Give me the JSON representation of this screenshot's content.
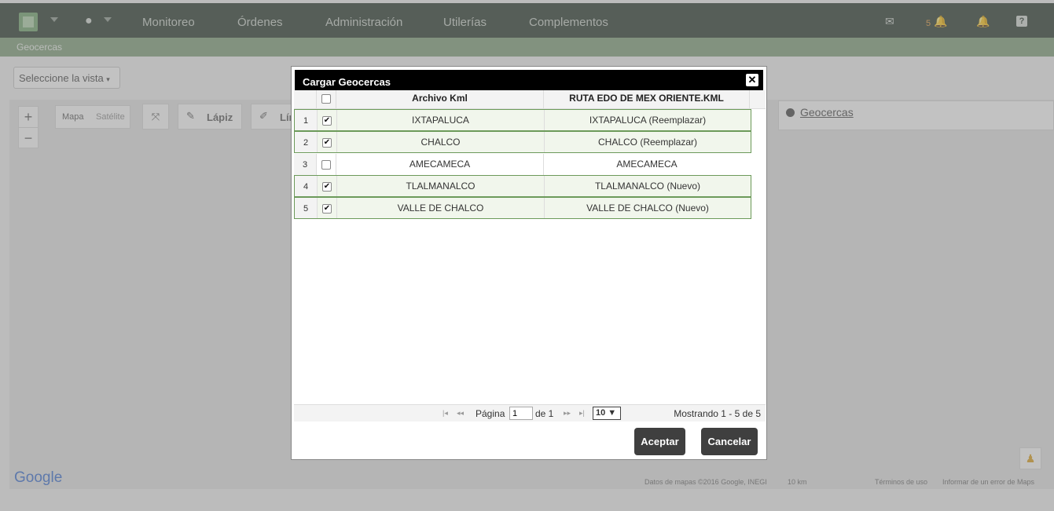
{
  "topbar": {
    "nav": [
      "Monitoreo",
      "Órdenes",
      "Administración",
      "Utilerías",
      "Complementos"
    ],
    "notifications_count": "5"
  },
  "subbar": {
    "title": "Geocercas"
  },
  "view_select": {
    "label": "Seleccione la vista"
  },
  "map": {
    "zoom_in": "+",
    "zoom_out": "−",
    "map_type": [
      "Mapa",
      "Satélite"
    ],
    "tool_pencil": "Lápiz",
    "tool_line": "Lín",
    "google": "Google",
    "footer": [
      "Datos de mapas ©2016 Google, INEGI",
      "10 km",
      "Términos de uso",
      "Informar de un error de Maps"
    ],
    "layers_link": "Geocercas"
  },
  "dialog": {
    "title": "Cargar Geocercas",
    "columns": [
      "Archivo Kml",
      "RUTA EDO DE MEX ORIENTE.KML"
    ],
    "rows": [
      {
        "num": "1",
        "checked": true,
        "archivo": "IXTAPALUCA",
        "ruta": "IXTAPALUCA (Reemplazar)"
      },
      {
        "num": "2",
        "checked": true,
        "archivo": "CHALCO",
        "ruta": "CHALCO (Reemplazar)"
      },
      {
        "num": "3",
        "checked": false,
        "archivo": "AMECAMECA",
        "ruta": "AMECAMECA"
      },
      {
        "num": "4",
        "checked": true,
        "archivo": "TLALMANALCO",
        "ruta": "TLALMANALCO (Nuevo)"
      },
      {
        "num": "5",
        "checked": true,
        "archivo": "VALLE DE CHALCO",
        "ruta": "VALLE DE CHALCO (Nuevo)"
      }
    ],
    "pager": {
      "page_label": "Página",
      "page_value": "1",
      "of_label": "de 1",
      "page_size": "10 ▼",
      "info": "Mostrando 1 - 5 de 5"
    },
    "accept": "Aceptar",
    "cancel": "Cancelar"
  }
}
